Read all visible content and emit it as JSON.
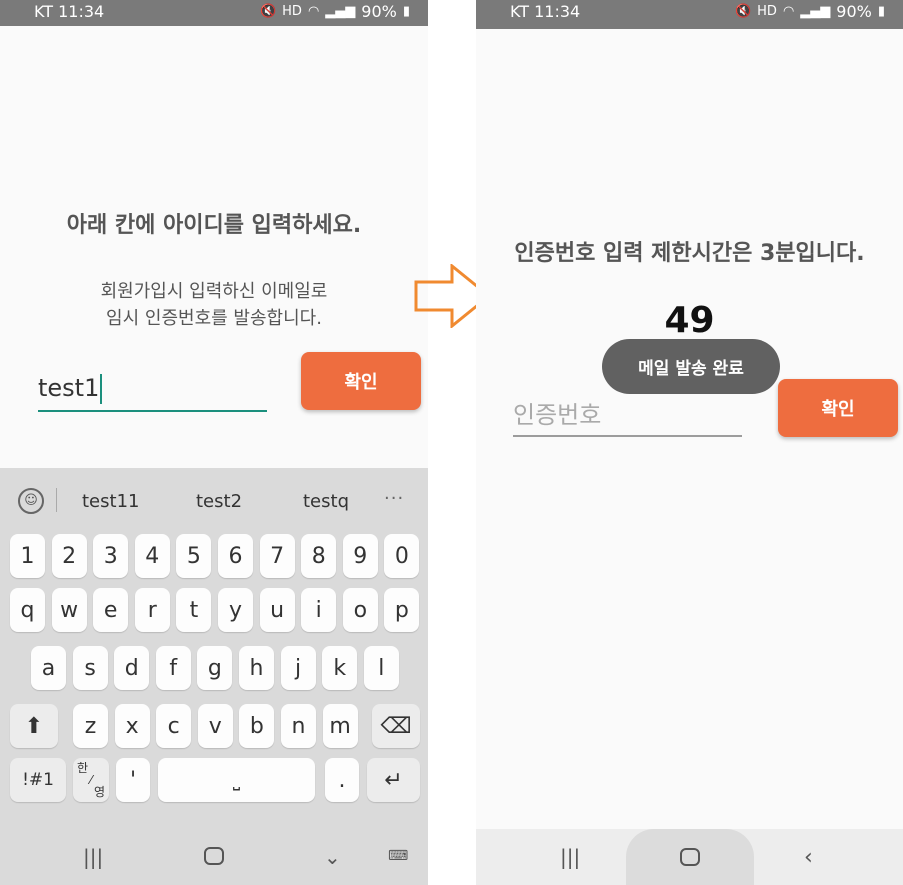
{
  "left_screen": {
    "status": {
      "carrier": "KT 11:34",
      "battery": "90%"
    },
    "title": "아래 칸에 아이디를 입력하세요.",
    "description_line1": "회원가입시 입력하신 이메일로",
    "description_line2": "임시 인증번호를 발송합니다.",
    "id_input_value": "test1",
    "confirm_label": "확인",
    "keyboard": {
      "suggestions": [
        "test11",
        "test2",
        "testq"
      ],
      "more": "···",
      "row_numbers": [
        "1",
        "2",
        "3",
        "4",
        "5",
        "6",
        "7",
        "8",
        "9",
        "0"
      ],
      "row_1": [
        "q",
        "w",
        "e",
        "r",
        "t",
        "y",
        "u",
        "i",
        "o",
        "p"
      ],
      "row_2": [
        "a",
        "s",
        "d",
        "f",
        "g",
        "h",
        "j",
        "k",
        "l"
      ],
      "row_3": [
        "z",
        "x",
        "c",
        "v",
        "b",
        "n",
        "m"
      ],
      "symbols_label": "!#1",
      "lang_top": "한",
      "lang_bottom": "영",
      "apostrophe": "'",
      "period": "."
    }
  },
  "right_screen": {
    "status": {
      "carrier": "KT 11:34",
      "battery": "90%"
    },
    "title": "인증번호 입력 제한시간은 3분입니다.",
    "timer": "49",
    "toast": "메일 발송 완료",
    "code_placeholder": "인증번호",
    "confirm_label": "확인"
  },
  "colors": {
    "accent": "#ee6d3f",
    "input_line": "#1b8f7d",
    "arrow": "#f08a30"
  },
  "icons": [
    "wifi-icon",
    "signal-icon",
    "mute-icon",
    "battery-icon",
    "arrow-right-icon",
    "back-icon",
    "home-icon",
    "recents-icon",
    "keyboard-icon",
    "shift-icon",
    "backspace-icon",
    "enter-icon",
    "space-icon",
    "emoji-icon"
  ]
}
